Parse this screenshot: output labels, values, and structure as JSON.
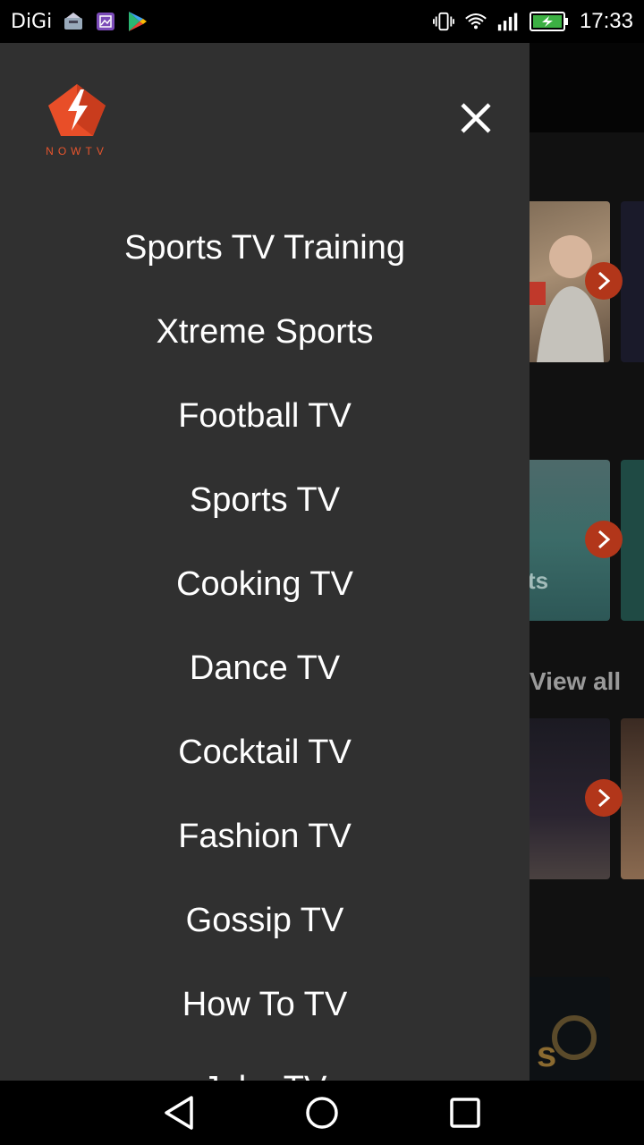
{
  "status_bar": {
    "carrier": "DiGi",
    "time": "17:33",
    "icons": [
      "mail-icon",
      "gallery-icon",
      "play-store-icon",
      "vibrate-icon",
      "wifi-icon",
      "signal-icon",
      "battery-charging-icon"
    ]
  },
  "app_background": {
    "view_all_label": "View all",
    "thumbnail_fragment_text": "ts"
  },
  "drawer": {
    "logo_text": "NOWTV",
    "close_icon": "close-icon",
    "menu_items": [
      "Sports TV Training",
      "Xtreme Sports",
      "Football TV",
      "Sports TV",
      "Cooking TV",
      "Dance TV",
      "Cocktail TV",
      "Fashion TV",
      "Gossip TV",
      "How To TV",
      "Juke TV"
    ]
  },
  "nav_bar": {
    "buttons": [
      "back-icon",
      "home-icon",
      "recents-icon"
    ]
  },
  "colors": {
    "drawer_bg": "#303030",
    "accent": "#e8552d",
    "arrow_button": "#b2361a"
  }
}
